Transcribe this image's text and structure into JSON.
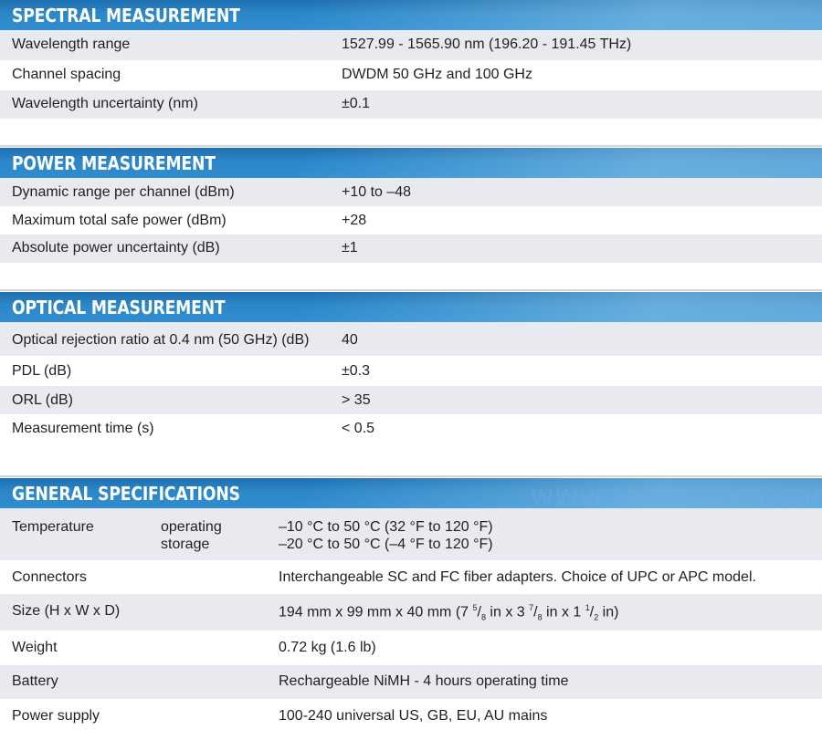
{
  "spectral": {
    "title": "SPECTRAL MEASUREMENT",
    "rows": [
      {
        "label": "Wavelength range",
        "value": "1527.99 - 1565.90 nm (196.20 - 191.45 THz)"
      },
      {
        "label": "Channel spacing",
        "value": "DWDM 50 GHz and 100 GHz"
      },
      {
        "label": "Wavelength uncertainty (nm)",
        "value": "±0.1"
      }
    ]
  },
  "power": {
    "title": "POWER MEASUREMENT",
    "rows": [
      {
        "label": "Dynamic range per channel (dBm)",
        "value": "+10 to –48"
      },
      {
        "label": "Maximum total safe power (dBm)",
        "value": "+28"
      },
      {
        "label": "Absolute power uncertainty (dB)",
        "value": "±1"
      }
    ]
  },
  "optical": {
    "title": "OPTICAL MEASUREMENT",
    "rows": [
      {
        "label": "Optical rejection ratio at 0.4 nm (50 GHz) (dB)",
        "value": "40"
      },
      {
        "label": "PDL (dB)",
        "value": "±0.3"
      },
      {
        "label": "ORL (dB)",
        "value": "> 35"
      },
      {
        "label": "Measurement time (s)",
        "value": "< 0.5"
      }
    ]
  },
  "general": {
    "title": "GENERAL SPECIFICATIONS",
    "temperature": {
      "label": "Temperature",
      "operating_label": "operating",
      "storage_label": "storage",
      "operating_value": "–10 °C to 50 °C (32 °F to 120 °F)",
      "storage_value": "–20 °C to 50 °C (–4 °F to 120 °F)"
    },
    "connectors": {
      "label": "Connectors",
      "value": "Interchangeable SC and FC fiber adapters. Choice of UPC or APC model."
    },
    "size": {
      "label": "Size (H x W x D)",
      "value_main": "194 mm x 99 mm x 40 mm (7 ",
      "f1_num": "5",
      "f1_den": "8",
      "mid1": " in x 3 ",
      "f2_num": "7",
      "f2_den": "8",
      "mid2": " in x 1 ",
      "f3_num": "1",
      "f3_den": "2",
      "tail": " in)"
    },
    "weight": {
      "label": "Weight",
      "value": "0.72 kg (1.6 lb)"
    },
    "battery": {
      "label": "Battery",
      "value": "Rechargeable NiMH - 4 hours operating time"
    },
    "power_supply": {
      "label": "Power supply",
      "value": "100-240 universal US, GB, EU, AU mains"
    }
  },
  "watermark": "www.tehencom.com"
}
